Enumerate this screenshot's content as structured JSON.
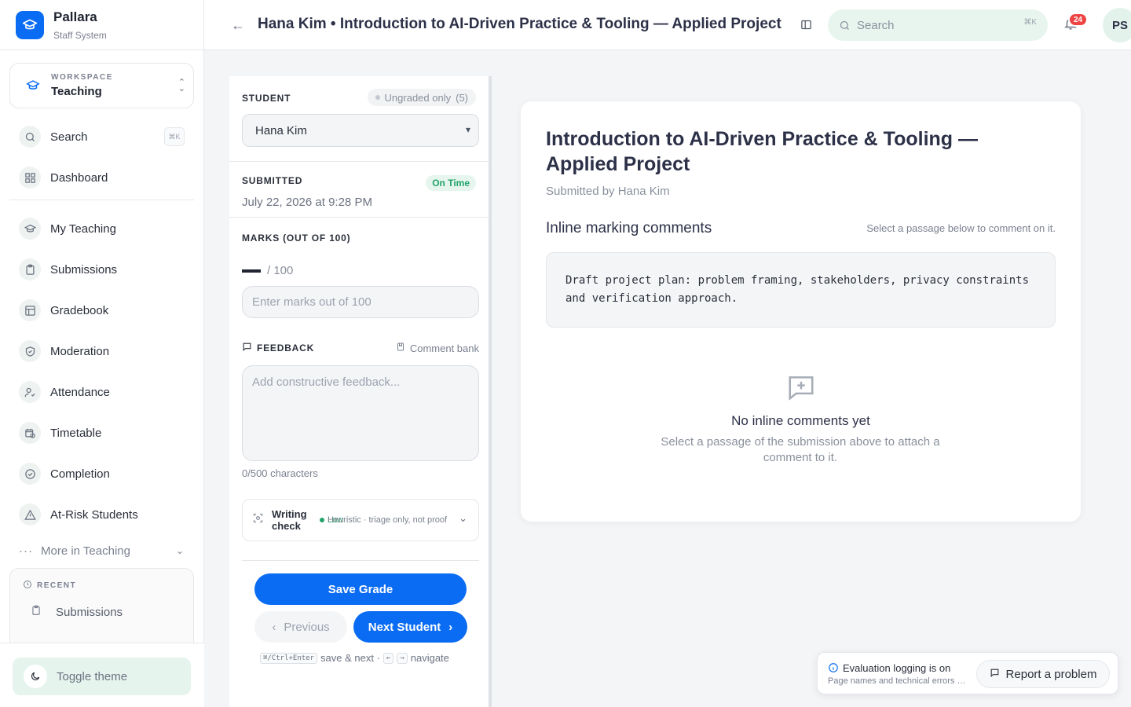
{
  "brand": {
    "name": "Pallara",
    "subtitle": "Staff System"
  },
  "workspace": {
    "label": "WORKSPACE",
    "value": "Teaching"
  },
  "sidebar": {
    "search": {
      "label": "Search",
      "shortcut": "⌘K"
    },
    "items": [
      {
        "label": "Dashboard",
        "icon": "grid-icon"
      },
      {
        "label": "My Teaching",
        "icon": "graduation-cap-icon"
      },
      {
        "label": "Submissions",
        "icon": "clipboard-icon"
      },
      {
        "label": "Gradebook",
        "icon": "table-icon"
      },
      {
        "label": "Moderation",
        "icon": "shield-check-icon"
      },
      {
        "label": "Attendance",
        "icon": "user-check-icon"
      },
      {
        "label": "Timetable",
        "icon": "calendar-clock-icon"
      },
      {
        "label": "Completion",
        "icon": "check-circle-icon"
      },
      {
        "label": "At-Risk Students",
        "icon": "warning-icon"
      }
    ],
    "more": "More in Teaching",
    "recent_label": "RECENT",
    "recent_item": "Submissions",
    "toggle_theme": "Toggle theme"
  },
  "topbar": {
    "title": "Hana Kim • Introduction to AI-Driven Practice & Tooling — Applied Project",
    "search_placeholder": "Search",
    "search_shortcut": "⌘K",
    "notifications": "24",
    "avatar": "PS"
  },
  "grading": {
    "student_label": "STUDENT",
    "ungraded": "Ungraded only",
    "ungraded_count": "(5)",
    "student_selected": "Hana Kim",
    "submitted_label": "SUBMITTED",
    "status": "On Time",
    "submitted_date": "July 22, 2026 at 9:28 PM",
    "marks_label": "MARKS (OUT OF 100)",
    "marks_total": "/ 100",
    "marks_placeholder": "Enter marks out of 100",
    "feedback_label": "FEEDBACK",
    "comment_bank": "Comment bank",
    "feedback_placeholder": "Add constructive feedback...",
    "char_count": "0/500 characters",
    "writing_check_title": "Writing check",
    "writing_check_level": "Low",
    "writing_check_note": "Heuristic · triage only, not proof",
    "save": "Save Grade",
    "previous": "Previous",
    "next": "Next Student",
    "shortcut_keys": "⌘/Ctrl+Enter",
    "shortcut_save": "save & next ·",
    "key_left": "←",
    "key_right": "→",
    "shortcut_nav": "navigate"
  },
  "submission": {
    "title": "Introduction to AI-Driven Practice & Tooling — Applied Project",
    "by": "Submitted by Hana Kim",
    "comments_heading": "Inline marking comments",
    "comments_hint": "Select a passage below to comment on it.",
    "passage": "Draft project plan: problem framing, stakeholders, privacy constraints and verification approach.",
    "empty_title": "No inline comments yet",
    "empty_sub": "Select a passage of the submission above to attach a comment to it."
  },
  "eval": {
    "title": "Evaluation logging is on",
    "sub": "Page names and technical errors are recorded",
    "report": "Report a problem"
  },
  "colors": {
    "accent": "#0a6cf2",
    "success": "#22a26a",
    "danger": "#ef4444"
  }
}
